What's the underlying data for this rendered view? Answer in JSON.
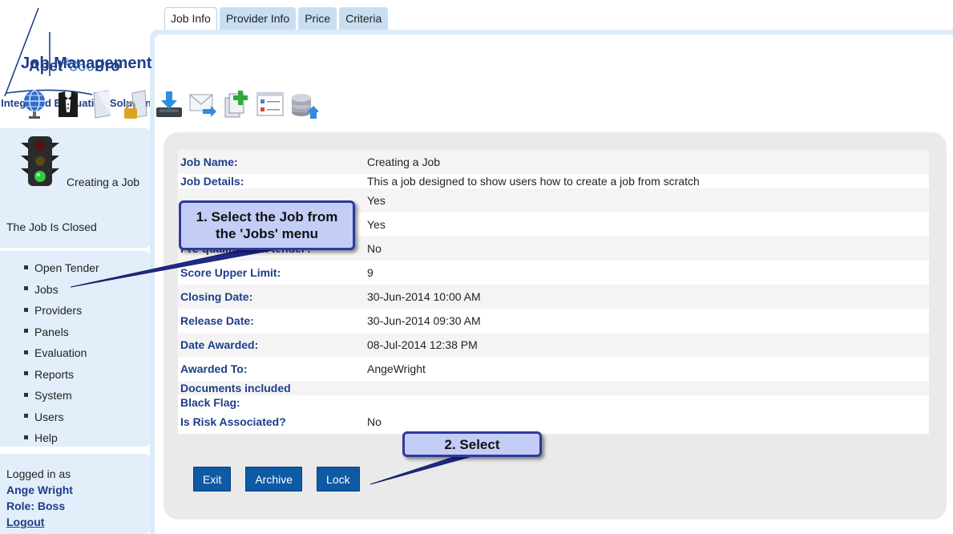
{
  "logo": {
    "brand_apet": "Apet",
    "brand_reg": "®",
    "brand_num": "360",
    "brand_pro": "Pro",
    "tagline": "Integrated Evaluation Solution"
  },
  "status": {
    "job_name": "Creating a Job",
    "job_state": "The Job Is Closed",
    "light_icon": "traffic-light-icon"
  },
  "nav": {
    "items": [
      {
        "label": "Open Tender"
      },
      {
        "label": "Jobs"
      },
      {
        "label": "Providers"
      },
      {
        "label": "Panels"
      },
      {
        "label": "Evaluation"
      },
      {
        "label": "Reports"
      },
      {
        "label": "System"
      },
      {
        "label": "Users"
      },
      {
        "label": "Help"
      }
    ]
  },
  "user": {
    "logged_in_label": "Logged in as",
    "name": "Ange Wright",
    "role": "Role: Boss",
    "logout": "Logout"
  },
  "tabs": [
    {
      "label": "Job Info",
      "active": true
    },
    {
      "label": "Provider Info"
    },
    {
      "label": "Price"
    },
    {
      "label": "Criteria"
    }
  ],
  "main": {
    "title": "Job Management",
    "toolbar_icons": [
      "globe-icon",
      "tuxedo-icon",
      "document-icon",
      "lock-document-icon",
      "download-tray-icon",
      "forward-mail-icon",
      "add-copy-icon",
      "form-list-icon",
      "database-upload-icon"
    ]
  },
  "details": [
    {
      "label": "Job Name:",
      "value": "Creating a Job"
    },
    {
      "label": "Job Details:",
      "value": "This a job designed to show users how to create a job from scratch"
    },
    {
      "label": "",
      "value": "Yes"
    },
    {
      "label": "",
      "value": "Yes"
    },
    {
      "label": "Pre-qualification tender?",
      "value": "No"
    },
    {
      "label": "Score Upper Limit:",
      "value": "9"
    },
    {
      "label": "Closing Date:",
      "value": "30-Jun-2014 10:00 AM"
    },
    {
      "label": "Release Date:",
      "value": "30-Jun-2014 09:30 AM"
    },
    {
      "label": "Date Awarded:",
      "value": "08-Jul-2014 12:38 PM"
    },
    {
      "label": "Awarded To:",
      "value": "AngeWright"
    },
    {
      "label": "Documents included",
      "value": ""
    },
    {
      "label": "Black Flag:",
      "value": ""
    },
    {
      "label": "Is Risk Associated?",
      "value": "No"
    }
  ],
  "buttons": {
    "exit": "Exit",
    "archive": "Archive",
    "lock": "Lock"
  },
  "callouts": {
    "step1_line1": "1. Select the Job from",
    "step1_line2": "the 'Jobs' menu",
    "step2": "2. Select"
  },
  "colors": {
    "brand_blue": "#1d3e8a",
    "sidebar_bg": "#e2eef9",
    "button_blue": "#0e5aa5",
    "callout_fill": "#c4cdf5",
    "callout_border": "#2e39a0"
  }
}
